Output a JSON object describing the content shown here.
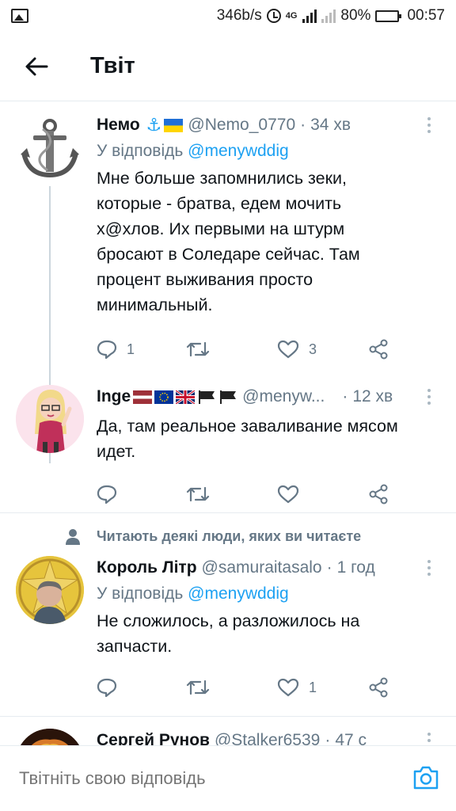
{
  "status_bar": {
    "speed": "346b/s",
    "network": "4G",
    "battery": "80%",
    "time": "00:57"
  },
  "header": {
    "title": "Твіт"
  },
  "tweets": [
    {
      "name": "Немо",
      "handle": "@Nemo_0770",
      "time": "34 хв",
      "reply_prefix": "У відповідь",
      "reply_to": "@menywddig",
      "text_lines": [
        "Мне больше запомнились зеки,",
        "которые - братва, едем мочить",
        "х@хлов. Их первыми на штурм",
        "бросают в Соледаре сейчас. Там",
        "процент выживания просто",
        "минимальный."
      ],
      "replies": "1",
      "retweets": "",
      "likes": "3"
    },
    {
      "name": "Inge",
      "handle": "@menyw...",
      "time": "12 хв",
      "text_lines": [
        "Да, там реальное заваливание мясом",
        "идет."
      ],
      "replies": "",
      "retweets": "",
      "likes": ""
    },
    {
      "name": "Король Літр",
      "handle": "@samuraitasalo",
      "time": "1 год",
      "reply_prefix": "У відповідь",
      "reply_to": "@menywddig",
      "text_lines": [
        "Не сложилось, а разложилось на",
        "запчасти."
      ],
      "replies": "",
      "retweets": "",
      "likes": "1"
    },
    {
      "name": "Сергей Рунов",
      "handle": "@Stalker6539",
      "time": "47 с"
    }
  ],
  "social_context": "Читають деякі люди, яких ви читаєте",
  "reply_bar": {
    "placeholder": "Твітніть свою відповідь"
  },
  "colors": {
    "accent": "#1da1f2",
    "secondary_text": "#657786",
    "primary_text": "#0f1419",
    "divider": "#e6ecf0"
  },
  "icons": [
    "gallery-icon",
    "alarm-icon",
    "battery-icon",
    "back-arrow-icon",
    "anchor-emoji",
    "ukraine-flag-icon",
    "reply-icon",
    "retweet-icon",
    "like-icon",
    "share-icon",
    "more-icon",
    "person-icon",
    "camera-icon"
  ]
}
